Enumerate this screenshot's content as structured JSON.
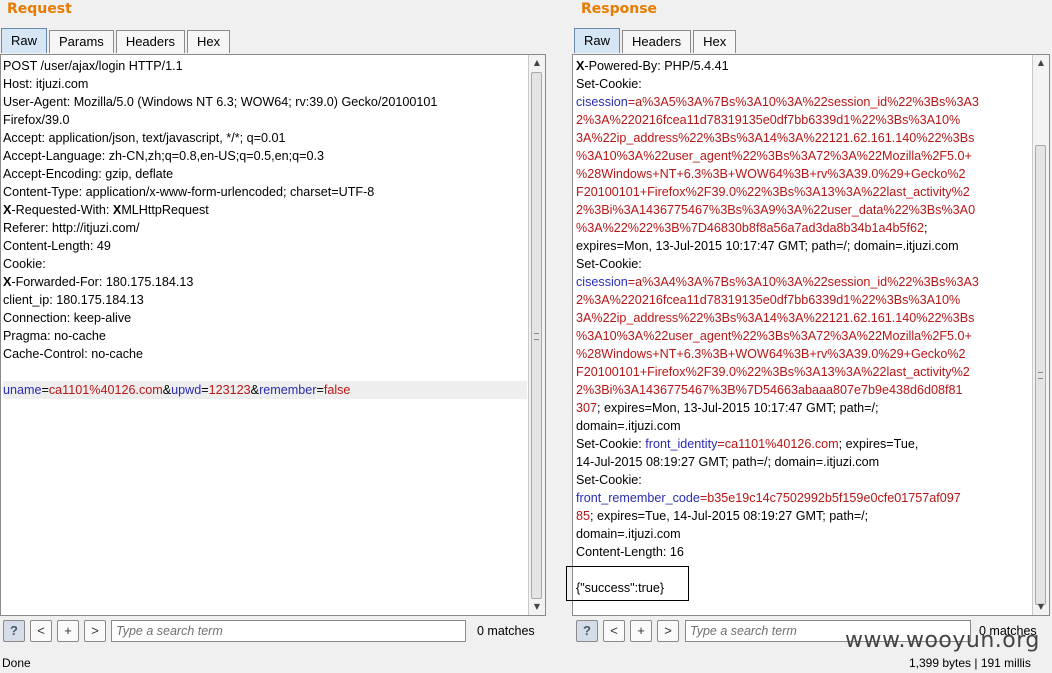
{
  "request": {
    "title": "Request",
    "tabs": [
      "Raw",
      "Params",
      "Headers",
      "Hex"
    ],
    "active_tab": "Raw",
    "lines": [
      [
        {
          "t": "POST /user/ajax/login HTTP/1.1"
        }
      ],
      [
        {
          "t": "Host: itjuzi.com"
        }
      ],
      [
        {
          "t": "User-Agent: Mozilla/5.0 (Windows NT 6.3; WOW64; rv:39.0) Gecko/20100101"
        }
      ],
      [
        {
          "t": "Firefox/39.0"
        }
      ],
      [
        {
          "t": "Accept: application/json, text/javascript, */*; q=0.01"
        }
      ],
      [
        {
          "t": "Accept-Language: zh-CN,zh;q=0.8,en-US;q=0.5,en;q=0.3"
        }
      ],
      [
        {
          "t": "Accept-Encoding: gzip, deflate"
        }
      ],
      [
        {
          "t": "Content-Type: application/x-www-form-urlencoded; charset=UTF-8"
        }
      ],
      [
        {
          "t": "X",
          "c": "kw"
        },
        {
          "t": "-Requested-With: "
        },
        {
          "t": "X",
          "c": "kw"
        },
        {
          "t": "MLHttpRequest"
        }
      ],
      [
        {
          "t": "Referer: http://itjuzi.com/"
        }
      ],
      [
        {
          "t": "Content-Length: 49"
        }
      ],
      [
        {
          "t": "Cookie:"
        }
      ],
      [
        {
          "t": "X",
          "c": "kw"
        },
        {
          "t": "-Forwarded-For: 180.175.184.13"
        }
      ],
      [
        {
          "t": "client_ip: 180.175.184.13"
        }
      ],
      [
        {
          "t": "Connection: keep-alive"
        }
      ],
      [
        {
          "t": "Pragma: no-cache"
        }
      ],
      [
        {
          "t": "Cache-Control: no-cache"
        }
      ],
      [
        {
          "t": ""
        }
      ],
      [
        {
          "t": "uname",
          "c": "pn"
        },
        {
          "t": "="
        },
        {
          "t": "ca1101%40126.com",
          "c": "pv"
        },
        {
          "t": "&"
        },
        {
          "t": "upwd",
          "c": "pn"
        },
        {
          "t": "="
        },
        {
          "t": "123123",
          "c": "pv"
        },
        {
          "t": "&"
        },
        {
          "t": "remember",
          "c": "pn"
        },
        {
          "t": "="
        },
        {
          "t": "false",
          "c": "pv"
        }
      ]
    ],
    "highlight_line": 18,
    "search_placeholder": "Type a search term",
    "matches": "0 matches"
  },
  "response": {
    "title": "Response",
    "tabs": [
      "Raw",
      "Headers",
      "Hex"
    ],
    "active_tab": "Raw",
    "lines": [
      [
        {
          "t": "X",
          "c": "kw"
        },
        {
          "t": "-Powered-By: PHP/5.4.41"
        }
      ],
      [
        {
          "t": "Set-Cookie:"
        }
      ],
      [
        {
          "t": "cisession",
          "c": "pn"
        },
        {
          "t": "=",
          "c": "pv"
        },
        {
          "t": "a%3A5%3A%7Bs%3A10%3A%22session_id%22%3Bs%3A3",
          "c": "pv"
        }
      ],
      [
        {
          "t": "2%3A%220216fcea11d78319135e0df7bb6339d1%22%3Bs%3A10%",
          "c": "pv"
        }
      ],
      [
        {
          "t": "3A%22ip_address%22%3Bs%3A14%3A%22121.62.161.140%22%3Bs",
          "c": "pv"
        }
      ],
      [
        {
          "t": "%3A10%3A%22user_agent%22%3Bs%3A72%3A%22Mozilla%2F5.0+",
          "c": "pv"
        }
      ],
      [
        {
          "t": "%28Windows+NT+6.3%3B+WOW64%3B+rv%3A39.0%29+Gecko%2",
          "c": "pv"
        }
      ],
      [
        {
          "t": "F20100101+Firefox%2F39.0%22%3Bs%3A13%3A%22last_activity%2",
          "c": "pv"
        }
      ],
      [
        {
          "t": "2%3Bi%3A1436775467%3Bs%3A9%3A%22user_data%22%3Bs%3A0",
          "c": "pv"
        }
      ],
      [
        {
          "t": "%3A%22%22%3B%7D46830b8f8a56a7ad3da8b34b1a4b5f62",
          "c": "pv"
        },
        {
          "t": ";"
        }
      ],
      [
        {
          "t": "expires=Mon, 13-Jul-2015 10:17:47 GMT; path=/; domain=.itjuzi.com"
        }
      ],
      [
        {
          "t": "Set-Cookie:"
        }
      ],
      [
        {
          "t": "cisession",
          "c": "pn"
        },
        {
          "t": "=",
          "c": "pv"
        },
        {
          "t": "a%3A4%3A%7Bs%3A10%3A%22session_id%22%3Bs%3A3",
          "c": "pv"
        }
      ],
      [
        {
          "t": "2%3A%220216fcea11d78319135e0df7bb6339d1%22%3Bs%3A10%",
          "c": "pv"
        }
      ],
      [
        {
          "t": "3A%22ip_address%22%3Bs%3A14%3A%22121.62.161.140%22%3Bs",
          "c": "pv"
        }
      ],
      [
        {
          "t": "%3A10%3A%22user_agent%22%3Bs%3A72%3A%22Mozilla%2F5.0+",
          "c": "pv"
        }
      ],
      [
        {
          "t": "%28Windows+NT+6.3%3B+WOW64%3B+rv%3A39.0%29+Gecko%2",
          "c": "pv"
        }
      ],
      [
        {
          "t": "F20100101+Firefox%2F39.0%22%3Bs%3A13%3A%22last_activity%2",
          "c": "pv"
        }
      ],
      [
        {
          "t": "2%3Bi%3A1436775467%3B%7D54663abaaa807e7b9e438d6d08f81",
          "c": "pv"
        }
      ],
      [
        {
          "t": "307",
          "c": "pv"
        },
        {
          "t": "; expires=Mon, 13-Jul-2015 10:17:47 GMT; path=/;"
        }
      ],
      [
        {
          "t": "domain=.itjuzi.com"
        }
      ],
      [
        {
          "t": "Set-Cookie: "
        },
        {
          "t": "front_identity",
          "c": "pn"
        },
        {
          "t": "=",
          "c": "pv"
        },
        {
          "t": "ca1101%40126.com",
          "c": "pv"
        },
        {
          "t": "; expires=Tue,"
        }
      ],
      [
        {
          "t": "14-Jul-2015 08:19:27 GMT; path=/; domain=.itjuzi.com"
        }
      ],
      [
        {
          "t": "Set-Cookie:"
        }
      ],
      [
        {
          "t": "front_remember_code",
          "c": "pn"
        },
        {
          "t": "=",
          "c": "pv"
        },
        {
          "t": "b35e19c14c7502992b5f159e0cfe01757af097",
          "c": "pv"
        }
      ],
      [
        {
          "t": "85",
          "c": "pv"
        },
        {
          "t": "; expires=Tue, 14-Jul-2015 08:19:27 GMT; path=/;"
        }
      ],
      [
        {
          "t": "domain=.itjuzi.com"
        }
      ],
      [
        {
          "t": "Content-Length: 16"
        }
      ],
      [
        {
          "t": ""
        }
      ],
      [
        {
          "t": "{\"success\":true}"
        }
      ]
    ],
    "search_placeholder": "Type a search term",
    "matches": "0 matches"
  },
  "search_buttons": {
    "help": "?",
    "prev": "<",
    "next_plus": "+",
    "next": ">"
  },
  "status": {
    "left": "Done",
    "right": "1,399 bytes | 191 millis"
  },
  "watermark": "www.wooyun.org",
  "colors": {
    "title": "#e87b00",
    "param_name": "#2a2cb0",
    "param_value": "#b81616",
    "active_tab": "#d6e6f5"
  }
}
